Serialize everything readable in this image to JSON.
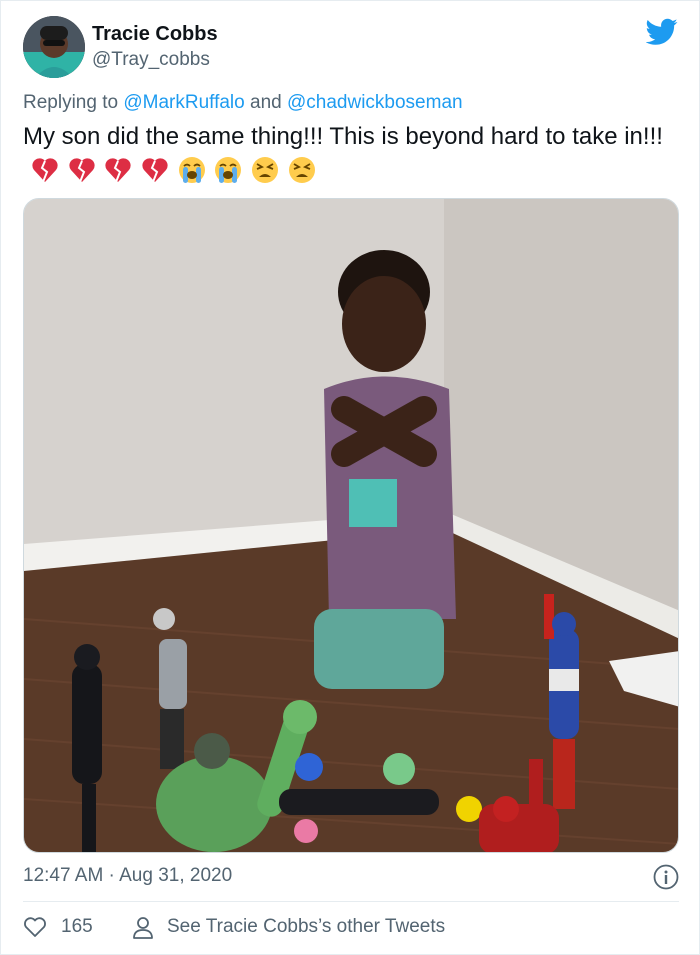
{
  "author": {
    "display_name": "Tracie Cobbs",
    "handle": "@Tray_cobbs"
  },
  "reply": {
    "prefix": "Replying to",
    "mention_1": "@MarkRuffalo",
    "joiner": "and",
    "mention_2": "@chadwickboseman"
  },
  "tweet": {
    "text": "My son did the same thing!!! This is beyond hard to take in!!!",
    "emojis": [
      "broken-heart",
      "broken-heart",
      "broken-heart",
      "broken-heart",
      "loudly-crying-face",
      "loudly-crying-face",
      "tired-face",
      "tired-face"
    ]
  },
  "meta": {
    "timestamp": "12:47 AM · Aug 31, 2020"
  },
  "actions": {
    "like_count": "165",
    "other_tweets_label": "See Tracie Cobbs’s other Tweets"
  },
  "colors": {
    "twitter_blue": "#1d9bf0",
    "secondary_text": "#536471",
    "primary_text": "#0f1419"
  },
  "icons": {
    "brand": "twitter-bird-icon",
    "info": "info-icon",
    "like": "heart-outline-icon",
    "profile": "person-icon"
  }
}
